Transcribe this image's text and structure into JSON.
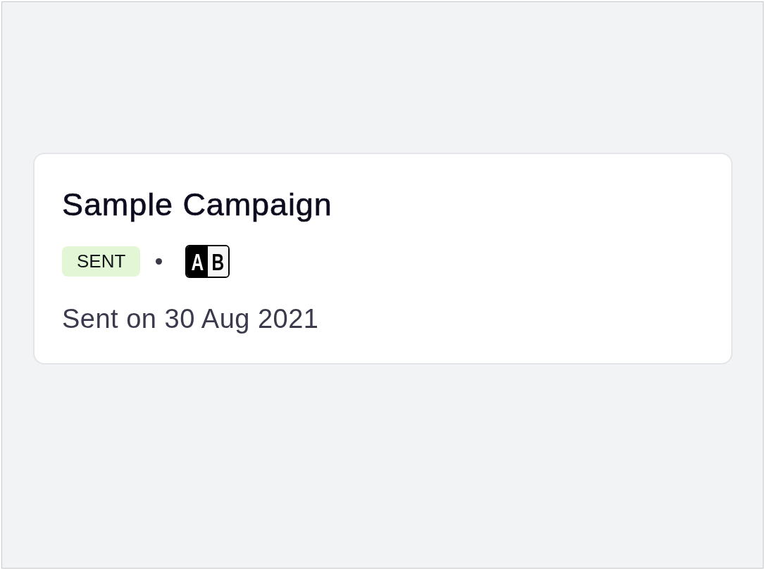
{
  "card": {
    "title": "Sample Campaign",
    "status": {
      "label": "SENT",
      "kind": "sent"
    },
    "ab_test": {
      "variants": [
        "A",
        "B"
      ]
    },
    "sent_date": "Sent on 30 Aug 2021"
  }
}
